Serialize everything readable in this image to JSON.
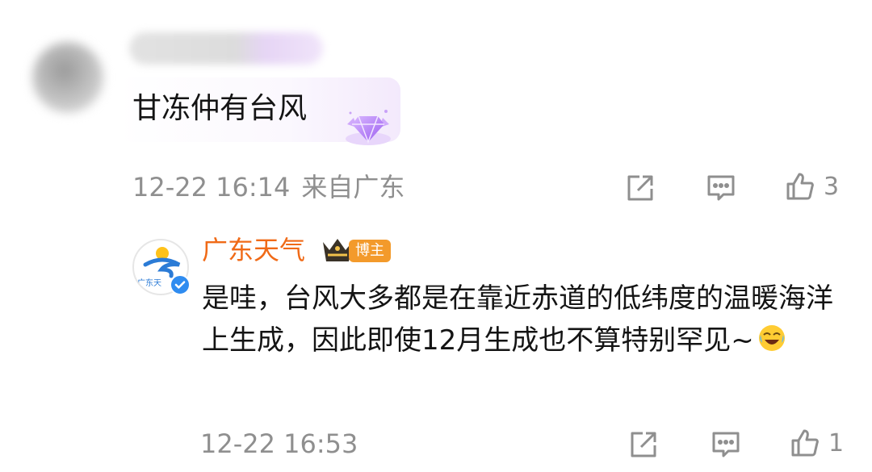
{
  "comment": {
    "text": "甘冻仲有台风",
    "time": "12-22 16:14",
    "location": "来自广东",
    "like_count": "3",
    "icons": [
      "share-icon",
      "comment-icon",
      "like-icon",
      "gem-badge-icon"
    ]
  },
  "reply": {
    "author": "广东天气",
    "badge": "博主",
    "avatar_text": "广东天",
    "text": "是哇，台风大多都是在靠近赤道的低纬度的温暖海洋上生成，因此即使12月生成也不算特别罕见~",
    "time": "12-22 16:53",
    "like_count": "1",
    "icons": [
      "crown-icon",
      "verified-icon",
      "laugh-cry-emoji-icon",
      "share-icon",
      "comment-icon",
      "like-icon"
    ]
  },
  "colors": {
    "author_orange": "#f06a17",
    "badge_orange": "#f39a2b",
    "meta_gray": "#8f8f8f",
    "verified_blue": "#2f8cf0"
  }
}
